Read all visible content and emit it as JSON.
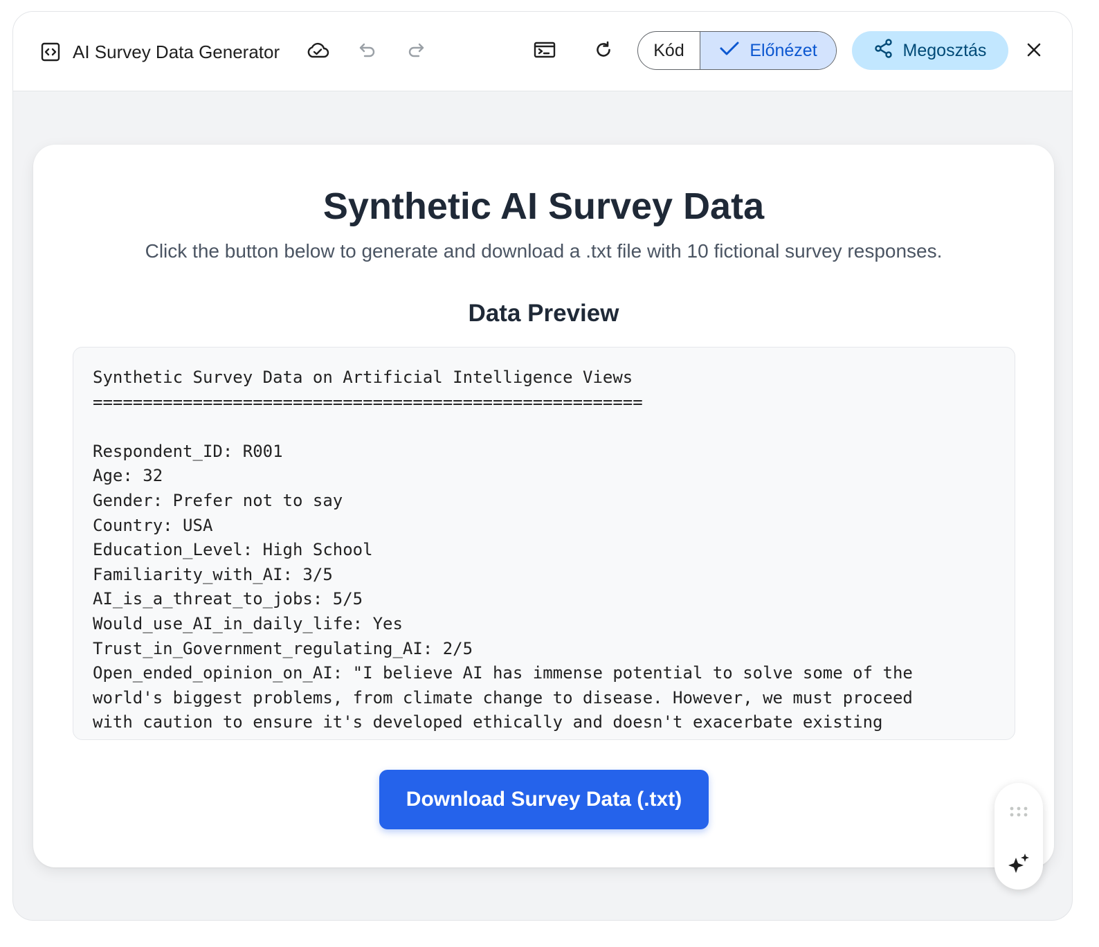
{
  "app": {
    "title": "AI Survey Data Generator"
  },
  "toolbar": {
    "code_label": "Kód",
    "preview_label": "Előnézet",
    "share_label": "Megosztás"
  },
  "page": {
    "title": "Synthetic AI Survey Data",
    "subtitle": "Click the button below to generate and download a .txt file with 10 fictional survey responses.",
    "preview_heading": "Data Preview",
    "download_label": "Download Survey Data (.txt)"
  },
  "preview": {
    "lines": [
      "Synthetic Survey Data on Artificial Intelligence Views",
      "=======================================================",
      "",
      "Respondent_ID: R001",
      "Age: 32",
      "Gender: Prefer not to say",
      "Country: USA",
      "Education_Level: High School",
      "Familiarity_with_AI: 3/5",
      "AI_is_a_threat_to_jobs: 5/5",
      "Would_use_AI_in_daily_life: Yes",
      "Trust_in_Government_regulating_AI: 2/5",
      "Open_ended_opinion_on_AI: \"I believe AI has immense potential to solve some of the",
      "world's biggest problems, from climate change to disease. However, we must proceed",
      "with caution to ensure it's developed ethically and doesn't exacerbate existing"
    ]
  },
  "icons": {
    "app": "code-window-icon",
    "cloud": "cloud-sync-icon",
    "undo": "undo-icon",
    "redo": "redo-icon",
    "terminal": "terminal-icon",
    "refresh": "refresh-icon",
    "check": "check-icon",
    "share": "share-icon",
    "close": "close-icon",
    "drag": "drag-handle-icon",
    "sparkle": "sparkle-icon"
  },
  "colors": {
    "accent": "#2563eb",
    "preview_toggle_bg": "#d3e3fd",
    "share_bg": "#c2e7ff"
  }
}
